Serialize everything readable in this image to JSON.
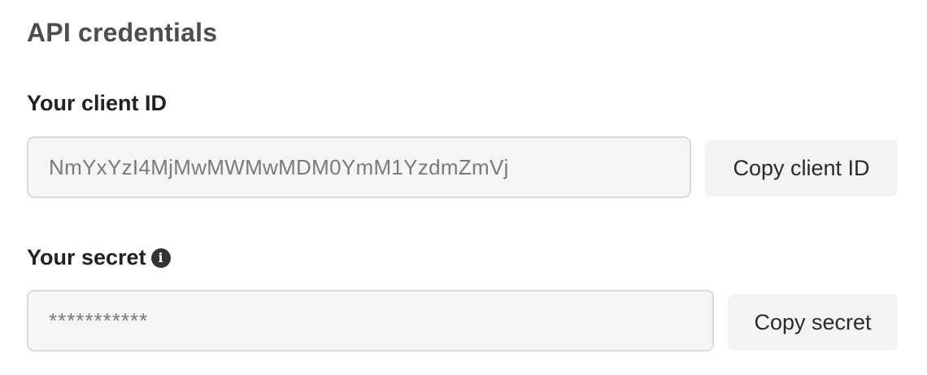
{
  "section": {
    "title": "API credentials"
  },
  "client_id": {
    "label": "Your client ID",
    "value": "NmYxYzI4MjMwMWMwMDM0YmM1YzdmZmVj",
    "copy_label": "Copy client ID"
  },
  "secret": {
    "label": "Your secret",
    "info_icon": "info-circle",
    "value": "***********",
    "copy_label": "Copy secret"
  }
}
